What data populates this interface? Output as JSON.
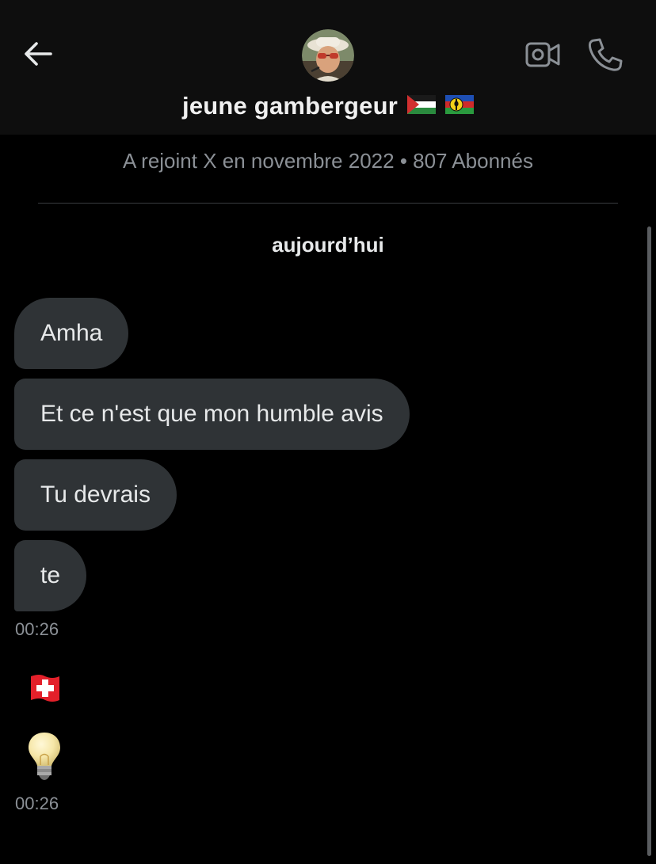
{
  "header": {
    "back_icon": "arrow-left-icon",
    "video_icon": "video-camera-icon",
    "phone_icon": "phone-icon",
    "username": "jeune gambergeur",
    "flags": [
      "palestine-flag",
      "new-caledonia-flag"
    ]
  },
  "profile": {
    "info": "A rejoint X en novembre 2022 • 807 Abonnés"
  },
  "date_separator": "aujourd’hui",
  "messages": [
    {
      "text": "Amha"
    },
    {
      "text": "Et ce n'est que mon humble avis"
    },
    {
      "text": "Tu devrais"
    },
    {
      "text": "te"
    }
  ],
  "timestamps": [
    "00:26",
    "00:26"
  ],
  "emoji_messages": [
    "swiss-flag-emoji",
    "light-bulb-emoji"
  ],
  "colors": {
    "background": "#000000",
    "header_bg": "#0e0e0e",
    "bubble": "#2f3336",
    "muted_text": "#8b9096"
  }
}
